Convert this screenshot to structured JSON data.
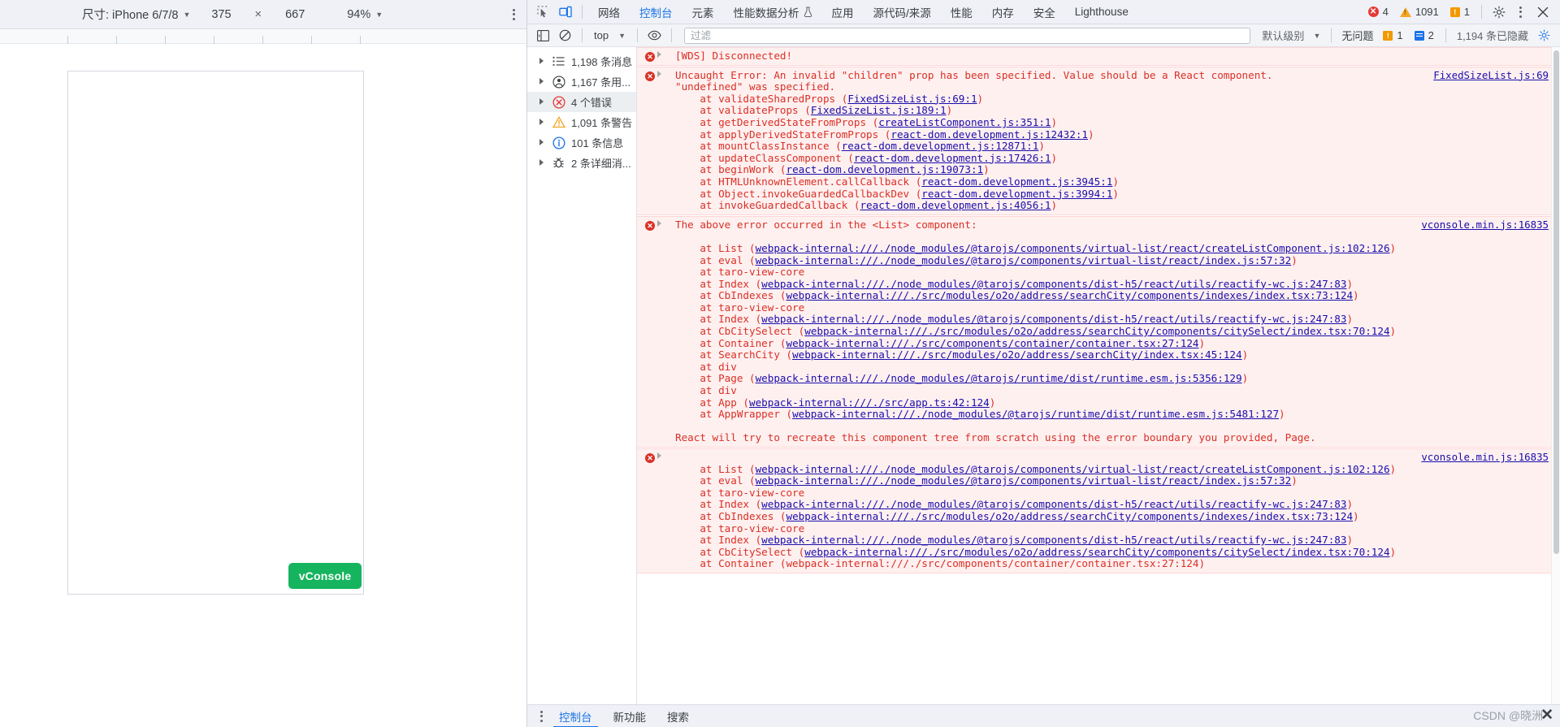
{
  "device_toolbar": {
    "size_label": "尺寸: iPhone 6/7/8",
    "width": "375",
    "times": "×",
    "height": "667",
    "zoom": "94%",
    "more_label": "more-options"
  },
  "device_preview": {
    "vconsole_button": "vConsole",
    "vconsole_color": "#16b45e"
  },
  "devtools": {
    "tabs": [
      {
        "label": "网络",
        "active": false
      },
      {
        "label": "控制台",
        "active": true
      },
      {
        "label": "元素",
        "active": false
      },
      {
        "label": "性能数据分析",
        "active": false,
        "flask": true
      },
      {
        "label": "应用",
        "active": false
      },
      {
        "label": "源代码/来源",
        "active": false
      },
      {
        "label": "性能",
        "active": false
      },
      {
        "label": "内存",
        "active": false
      },
      {
        "label": "安全",
        "active": false
      },
      {
        "label": "Lighthouse",
        "active": false
      }
    ],
    "status": {
      "error_count": "4",
      "warning_count": "1091",
      "issue_count": "1",
      "error_color": "#e53935",
      "warning_color": "#f5a623",
      "issue_color": "#f29900"
    }
  },
  "console_filterbar": {
    "context": "top",
    "filter_placeholder": "过滤",
    "filter_value": "",
    "level": "默认级别",
    "no_issues": "无问题",
    "issue_badge_count": "1",
    "message_badge_count": "2",
    "hidden_count": "1,194 条已隐藏"
  },
  "console_sidebar": [
    {
      "label": "1,198 条消息",
      "icon": "list-icon",
      "selected": false
    },
    {
      "label": "1,167 条用...",
      "icon": "user-icon",
      "selected": false
    },
    {
      "label": "4 个错误",
      "icon": "error-icon",
      "selected": true
    },
    {
      "label": "1,091 条警告",
      "icon": "warning-icon",
      "selected": false
    },
    {
      "label": "101 条信息",
      "icon": "info-icon",
      "selected": false
    },
    {
      "label": "2 条详细消...",
      "icon": "verbose-bug-icon",
      "selected": false
    }
  ],
  "console_messages": [
    {
      "id": "msg-wds",
      "source": "",
      "lines": [
        {
          "parts": [
            {
              "t": "[WDS] Disconnected!",
              "link": false
            }
          ]
        }
      ]
    },
    {
      "id": "msg-uncaught-error",
      "source": "FixedSizeList.js:69",
      "lines": [
        {
          "parts": [
            {
              "t": "Uncaught Error: An invalid \"children\" prop has been specified. Value should be a React component.",
              "link": false
            }
          ]
        },
        {
          "parts": [
            {
              "t": "\"undefined\" was specified.",
              "link": false
            }
          ],
          "indent": 0
        },
        {
          "parts": [
            {
              "t": "    at validateSharedProps (",
              "link": false
            },
            {
              "t": "FixedSizeList.js:69:1",
              "link": true
            },
            {
              "t": ")",
              "link": false
            }
          ]
        },
        {
          "parts": [
            {
              "t": "    at validateProps (",
              "link": false
            },
            {
              "t": "FixedSizeList.js:189:1",
              "link": true
            },
            {
              "t": ")",
              "link": false
            }
          ]
        },
        {
          "parts": [
            {
              "t": "    at getDerivedStateFromProps (",
              "link": false
            },
            {
              "t": "createListComponent.js:351:1",
              "link": true
            },
            {
              "t": ")",
              "link": false
            }
          ]
        },
        {
          "parts": [
            {
              "t": "    at applyDerivedStateFromProps (",
              "link": false
            },
            {
              "t": "react-dom.development.js:12432:1",
              "link": true
            },
            {
              "t": ")",
              "link": false
            }
          ]
        },
        {
          "parts": [
            {
              "t": "    at mountClassInstance (",
              "link": false
            },
            {
              "t": "react-dom.development.js:12871:1",
              "link": true
            },
            {
              "t": ")",
              "link": false
            }
          ]
        },
        {
          "parts": [
            {
              "t": "    at updateClassComponent (",
              "link": false
            },
            {
              "t": "react-dom.development.js:17426:1",
              "link": true
            },
            {
              "t": ")",
              "link": false
            }
          ]
        },
        {
          "parts": [
            {
              "t": "    at beginWork (",
              "link": false
            },
            {
              "t": "react-dom.development.js:19073:1",
              "link": true
            },
            {
              "t": ")",
              "link": false
            }
          ]
        },
        {
          "parts": [
            {
              "t": "    at HTMLUnknownElement.callCallback (",
              "link": false
            },
            {
              "t": "react-dom.development.js:3945:1",
              "link": true
            },
            {
              "t": ")",
              "link": false
            }
          ]
        },
        {
          "parts": [
            {
              "t": "    at Object.invokeGuardedCallbackDev (",
              "link": false
            },
            {
              "t": "react-dom.development.js:3994:1",
              "link": true
            },
            {
              "t": ")",
              "link": false
            }
          ]
        },
        {
          "parts": [
            {
              "t": "    at invokeGuardedCallback (",
              "link": false
            },
            {
              "t": "react-dom.development.js:4056:1",
              "link": true
            },
            {
              "t": ")",
              "link": false
            }
          ]
        }
      ]
    },
    {
      "id": "msg-above-error",
      "source": "vconsole.min.js:16835",
      "lines": [
        {
          "parts": [
            {
              "t": "The above error occurred in the <List> component:",
              "link": false
            }
          ]
        },
        {
          "parts": [
            {
              "t": "",
              "link": false
            }
          ]
        },
        {
          "parts": [
            {
              "t": "    at List (",
              "link": false
            },
            {
              "t": "webpack-internal:///./node_modules/@tarojs/components/virtual-list/react/createListComponent.js:102:126",
              "link": true
            },
            {
              "t": ")",
              "link": false
            }
          ]
        },
        {
          "parts": [
            {
              "t": "    at eval (",
              "link": false
            },
            {
              "t": "webpack-internal:///./node_modules/@tarojs/components/virtual-list/react/index.js:57:32",
              "link": true
            },
            {
              "t": ")",
              "link": false
            }
          ]
        },
        {
          "parts": [
            {
              "t": "    at taro-view-core",
              "link": false
            }
          ]
        },
        {
          "parts": [
            {
              "t": "    at Index (",
              "link": false
            },
            {
              "t": "webpack-internal:///./node_modules/@tarojs/components/dist-h5/react/utils/reactify-wc.js:247:83",
              "link": true
            },
            {
              "t": ")",
              "link": false
            }
          ]
        },
        {
          "parts": [
            {
              "t": "    at CbIndexes (",
              "link": false
            },
            {
              "t": "webpack-internal:///./src/modules/o2o/address/searchCity/components/indexes/index.tsx:73:124",
              "link": true
            },
            {
              "t": ")",
              "link": false
            }
          ]
        },
        {
          "parts": [
            {
              "t": "    at taro-view-core",
              "link": false
            }
          ]
        },
        {
          "parts": [
            {
              "t": "    at Index (",
              "link": false
            },
            {
              "t": "webpack-internal:///./node_modules/@tarojs/components/dist-h5/react/utils/reactify-wc.js:247:83",
              "link": true
            },
            {
              "t": ")",
              "link": false
            }
          ]
        },
        {
          "parts": [
            {
              "t": "    at CbCitySelect (",
              "link": false
            },
            {
              "t": "webpack-internal:///./src/modules/o2o/address/searchCity/components/citySelect/index.tsx:70:124",
              "link": true
            },
            {
              "t": ")",
              "link": false
            }
          ]
        },
        {
          "parts": [
            {
              "t": "    at Container (",
              "link": false
            },
            {
              "t": "webpack-internal:///./src/components/container/container.tsx:27:124",
              "link": true
            },
            {
              "t": ")",
              "link": false
            }
          ]
        },
        {
          "parts": [
            {
              "t": "    at SearchCity (",
              "link": false
            },
            {
              "t": "webpack-internal:///./src/modules/o2o/address/searchCity/index.tsx:45:124",
              "link": true
            },
            {
              "t": ")",
              "link": false
            }
          ]
        },
        {
          "parts": [
            {
              "t": "    at div",
              "link": false
            }
          ]
        },
        {
          "parts": [
            {
              "t": "    at Page (",
              "link": false
            },
            {
              "t": "webpack-internal:///./node_modules/@tarojs/runtime/dist/runtime.esm.js:5356:129",
              "link": true
            },
            {
              "t": ")",
              "link": false
            }
          ]
        },
        {
          "parts": [
            {
              "t": "    at div",
              "link": false
            }
          ]
        },
        {
          "parts": [
            {
              "t": "    at App (",
              "link": false
            },
            {
              "t": "webpack-internal:///./src/app.ts:42:124",
              "link": true
            },
            {
              "t": ")",
              "link": false
            }
          ]
        },
        {
          "parts": [
            {
              "t": "    at AppWrapper (",
              "link": false
            },
            {
              "t": "webpack-internal:///./node_modules/@tarojs/runtime/dist/runtime.esm.js:5481:127",
              "link": true
            },
            {
              "t": ")",
              "link": false
            }
          ]
        },
        {
          "parts": [
            {
              "t": "",
              "link": false
            }
          ]
        },
        {
          "parts": [
            {
              "t": "React will try to recreate this component tree from scratch using the error boundary you provided, Page.",
              "link": false
            }
          ]
        }
      ]
    },
    {
      "id": "msg-repeat-error",
      "source": "vconsole.min.js:16835",
      "lines": [
        {
          "parts": [
            {
              "t": "",
              "link": false
            }
          ]
        },
        {
          "parts": [
            {
              "t": "    at List (",
              "link": false
            },
            {
              "t": "webpack-internal:///./node_modules/@tarojs/components/virtual-list/react/createListComponent.js:102:126",
              "link": true
            },
            {
              "t": ")",
              "link": false
            }
          ]
        },
        {
          "parts": [
            {
              "t": "    at eval (",
              "link": false
            },
            {
              "t": "webpack-internal:///./node_modules/@tarojs/components/virtual-list/react/index.js:57:32",
              "link": true
            },
            {
              "t": ")",
              "link": false
            }
          ]
        },
        {
          "parts": [
            {
              "t": "    at taro-view-core",
              "link": false
            }
          ]
        },
        {
          "parts": [
            {
              "t": "    at Index (",
              "link": false
            },
            {
              "t": "webpack-internal:///./node_modules/@tarojs/components/dist-h5/react/utils/reactify-wc.js:247:83",
              "link": true
            },
            {
              "t": ")",
              "link": false
            }
          ]
        },
        {
          "parts": [
            {
              "t": "    at CbIndexes (",
              "link": false
            },
            {
              "t": "webpack-internal:///./src/modules/o2o/address/searchCity/components/indexes/index.tsx:73:124",
              "link": true
            },
            {
              "t": ")",
              "link": false
            }
          ]
        },
        {
          "parts": [
            {
              "t": "    at taro-view-core",
              "link": false
            }
          ]
        },
        {
          "parts": [
            {
              "t": "    at Index (",
              "link": false
            },
            {
              "t": "webpack-internal:///./node_modules/@tarojs/components/dist-h5/react/utils/reactify-wc.js:247:83",
              "link": true
            },
            {
              "t": ")",
              "link": false
            }
          ]
        },
        {
          "parts": [
            {
              "t": "    at CbCitySelect (",
              "link": false
            },
            {
              "t": "webpack-internal:///./src/modules/o2o/address/searchCity/components/citySelect/index.tsx:70:124",
              "link": true
            },
            {
              "t": ")",
              "link": false
            }
          ]
        },
        {
          "parts": [
            {
              "t": "    at Container (webpack-internal:///./src/components/container/container.tsx:27:124)",
              "link": false
            }
          ]
        }
      ]
    }
  ],
  "bottom_bar": {
    "tabs": [
      {
        "label": "控制台",
        "active": true
      },
      {
        "label": "新功能",
        "active": false
      },
      {
        "label": "搜索",
        "active": false
      }
    ]
  },
  "watermark": {
    "text": "CSDN @晓洲"
  }
}
